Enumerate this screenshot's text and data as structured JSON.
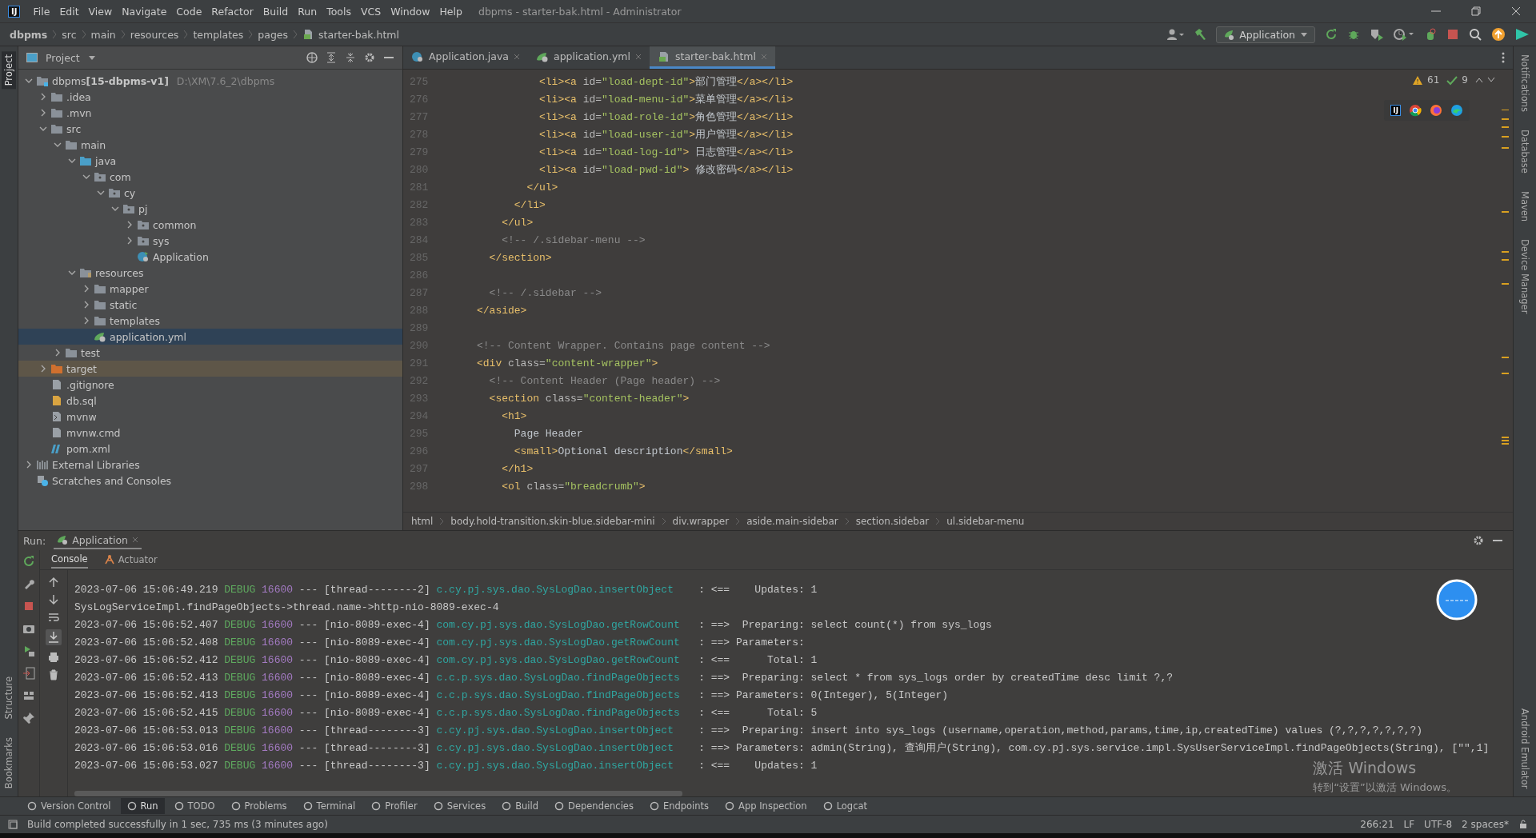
{
  "title_bar": {
    "logo": "IJ",
    "menu": [
      "File",
      "Edit",
      "View",
      "Navigate",
      "Code",
      "Refactor",
      "Build",
      "Run",
      "Tools",
      "VCS",
      "Window",
      "Help"
    ],
    "title": "dbpms - starter-bak.html - Administrator"
  },
  "nav_bar": {
    "breadcrumbs": [
      {
        "label": "dbpms",
        "kind": "project"
      },
      {
        "label": "src",
        "kind": "dir"
      },
      {
        "label": "main",
        "kind": "dir"
      },
      {
        "label": "resources",
        "kind": "dir"
      },
      {
        "label": "templates",
        "kind": "dir"
      },
      {
        "label": "pages",
        "kind": "dir"
      },
      {
        "label": "starter-bak.html",
        "kind": "html"
      }
    ],
    "run_config": "Application"
  },
  "left_stripe": {
    "top": [
      {
        "label": "Project",
        "selected": true
      }
    ],
    "bottom": [
      {
        "label": "Structure",
        "selected": false
      },
      {
        "label": "Bookmarks",
        "selected": false
      }
    ]
  },
  "right_stripe": {
    "top": [
      {
        "label": "Notifications",
        "selected": false
      },
      {
        "label": "Database",
        "selected": false
      },
      {
        "label": "Maven",
        "selected": false
      },
      {
        "label": "Device Manager",
        "selected": false
      }
    ],
    "bottom": [
      {
        "label": "Android Emulator",
        "selected": false
      }
    ]
  },
  "project": {
    "title": "Project",
    "tree": [
      {
        "label": "dbpms",
        "module": "[15-dbpms-v1]",
        "path": "D:\\XM\\7.6_2\\dbpms",
        "kind": "module",
        "expanded": true,
        "selected": false,
        "children": [
          {
            "label": ".idea",
            "kind": "folder",
            "expanded": false,
            "selected": false
          },
          {
            "label": ".mvn",
            "kind": "folder",
            "expanded": false,
            "selected": false
          },
          {
            "label": "src",
            "kind": "folder",
            "expanded": true,
            "selected": false,
            "children": [
              {
                "label": "main",
                "kind": "folder",
                "expanded": true,
                "selected": false,
                "children": [
                  {
                    "label": "java",
                    "kind": "source",
                    "expanded": true,
                    "selected": false,
                    "children": [
                      {
                        "label": "com",
                        "kind": "package",
                        "expanded": true,
                        "selected": false,
                        "children": [
                          {
                            "label": "cy",
                            "kind": "package",
                            "expanded": true,
                            "selected": false,
                            "children": [
                              {
                                "label": "pj",
                                "kind": "package",
                                "expanded": true,
                                "selected": false,
                                "children": [
                                  {
                                    "label": "common",
                                    "kind": "package",
                                    "expanded": false,
                                    "selected": false
                                  },
                                  {
                                    "label": "sys",
                                    "kind": "package",
                                    "expanded": false,
                                    "selected": false
                                  },
                                  {
                                    "label": "Application",
                                    "kind": "class",
                                    "selected": false
                                  }
                                ]
                              }
                            ]
                          }
                        ]
                      }
                    ]
                  },
                  {
                    "label": "resources",
                    "kind": "resources",
                    "expanded": true,
                    "selected": false,
                    "children": [
                      {
                        "label": "mapper",
                        "kind": "folder",
                        "expanded": false,
                        "selected": false
                      },
                      {
                        "label": "static",
                        "kind": "folder",
                        "expanded": false,
                        "selected": false
                      },
                      {
                        "label": "templates",
                        "kind": "folder",
                        "expanded": false,
                        "selected": false
                      },
                      {
                        "label": "application.yml",
                        "kind": "yml",
                        "selected": true
                      }
                    ]
                  }
                ]
              },
              {
                "label": "test",
                "kind": "folder",
                "expanded": false,
                "selected": false
              }
            ]
          },
          {
            "label": "target",
            "kind": "excluded",
            "expanded": false,
            "selected": false
          },
          {
            "label": ".gitignore",
            "kind": "file",
            "selected": false
          },
          {
            "label": "db.sql",
            "kind": "sql",
            "selected": false
          },
          {
            "label": "mvnw",
            "kind": "script",
            "selected": false
          },
          {
            "label": "mvnw.cmd",
            "kind": "file",
            "selected": false
          },
          {
            "label": "pom.xml",
            "kind": "maven",
            "selected": false
          }
        ]
      },
      {
        "label": "External Libraries",
        "kind": "libraries",
        "expanded": false,
        "selected": false
      },
      {
        "label": "Scratches and Consoles",
        "kind": "scratches",
        "selected": false
      }
    ]
  },
  "editor": {
    "tabs": [
      {
        "label": "Application.java",
        "kind": "class",
        "selected": false
      },
      {
        "label": "application.yml",
        "kind": "yml",
        "selected": false
      },
      {
        "label": "starter-bak.html",
        "kind": "html",
        "selected": true
      }
    ],
    "warnings": "61",
    "checks": "9",
    "browser_logo": "IJ",
    "lines": [
      {
        "number": "275",
        "code": [
          {
            "text": "          <li><a ",
            "kind": "tag"
          },
          {
            "text": "id=",
            "kind": "attr"
          },
          {
            "text": "\"load-dept-id\"",
            "kind": "str"
          },
          {
            "text": ">",
            "kind": "tag"
          },
          {
            "text": "部门管理",
            "kind": "text"
          },
          {
            "text": "</a></li>",
            "kind": "tag"
          }
        ]
      },
      {
        "number": "276",
        "code": [
          {
            "text": "          <li><a ",
            "kind": "tag"
          },
          {
            "text": "id=",
            "kind": "attr"
          },
          {
            "text": "\"load-menu-id\"",
            "kind": "str"
          },
          {
            "text": ">",
            "kind": "tag"
          },
          {
            "text": "菜单管理",
            "kind": "text"
          },
          {
            "text": "</a></li>",
            "kind": "tag"
          }
        ]
      },
      {
        "number": "277",
        "code": [
          {
            "text": "          <li><a ",
            "kind": "tag"
          },
          {
            "text": "id=",
            "kind": "attr"
          },
          {
            "text": "\"load-role-id\"",
            "kind": "str"
          },
          {
            "text": ">",
            "kind": "tag"
          },
          {
            "text": "角色管理",
            "kind": "text"
          },
          {
            "text": "</a></li>",
            "kind": "tag"
          }
        ]
      },
      {
        "number": "278",
        "code": [
          {
            "text": "          <li><a ",
            "kind": "tag"
          },
          {
            "text": "id=",
            "kind": "attr"
          },
          {
            "text": "\"load-user-id\"",
            "kind": "str"
          },
          {
            "text": ">",
            "kind": "tag"
          },
          {
            "text": "用户管理",
            "kind": "text"
          },
          {
            "text": "</a></li>",
            "kind": "tag"
          }
        ]
      },
      {
        "number": "279",
        "code": [
          {
            "text": "          <li><a ",
            "kind": "tag"
          },
          {
            "text": "id=",
            "kind": "attr"
          },
          {
            "text": "\"load-log-id\"",
            "kind": "str"
          },
          {
            "text": ">",
            "kind": "tag"
          },
          {
            "text": " 日志管理",
            "kind": "text"
          },
          {
            "text": "</a></li>",
            "kind": "tag"
          }
        ]
      },
      {
        "number": "280",
        "code": [
          {
            "text": "          <li><a ",
            "kind": "tag"
          },
          {
            "text": "id=",
            "kind": "attr"
          },
          {
            "text": "\"load-pwd-id\"",
            "kind": "str"
          },
          {
            "text": ">",
            "kind": "tag"
          },
          {
            "text": " 修改密码",
            "kind": "text"
          },
          {
            "text": "</a></li>",
            "kind": "tag"
          }
        ]
      },
      {
        "number": "281",
        "code": [
          {
            "text": "        </ul>",
            "kind": "tag"
          }
        ]
      },
      {
        "number": "282",
        "code": [
          {
            "text": "      </li>",
            "kind": "tag"
          }
        ]
      },
      {
        "number": "283",
        "code": [
          {
            "text": "    </ul>",
            "kind": "tag"
          }
        ]
      },
      {
        "number": "284",
        "code": [
          {
            "text": "    <!-- /.sidebar-menu -->",
            "kind": "comment"
          }
        ]
      },
      {
        "number": "285",
        "code": [
          {
            "text": "  </section>",
            "kind": "tag"
          }
        ]
      },
      {
        "number": "286"
      },
      {
        "number": "287",
        "code": [
          {
            "text": "  <!-- /.sidebar -->",
            "kind": "comment"
          }
        ]
      },
      {
        "number": "288",
        "code": [
          {
            "text": "</aside>",
            "kind": "tag"
          }
        ]
      },
      {
        "number": "289"
      },
      {
        "number": "290",
        "code": [
          {
            "text": "<!-- Content Wrapper. Contains page content -->",
            "kind": "comment"
          }
        ]
      },
      {
        "number": "291",
        "code": [
          {
            "text": "<div ",
            "kind": "tag"
          },
          {
            "text": "class=",
            "kind": "attr"
          },
          {
            "text": "\"content-wrapper\"",
            "kind": "str"
          },
          {
            "text": ">",
            "kind": "tag"
          }
        ]
      },
      {
        "number": "292",
        "code": [
          {
            "text": "  <!-- Content Header (Page header) -->",
            "kind": "comment"
          }
        ]
      },
      {
        "number": "293",
        "code": [
          {
            "text": "  <section ",
            "kind": "tag"
          },
          {
            "text": "class=",
            "kind": "attr"
          },
          {
            "text": "\"content-header\"",
            "kind": "str"
          },
          {
            "text": ">",
            "kind": "tag"
          }
        ]
      },
      {
        "number": "294",
        "code": [
          {
            "text": "    <h1>",
            "kind": "tag"
          }
        ]
      },
      {
        "number": "295",
        "code": [
          {
            "text": "      Page Header",
            "kind": "text"
          }
        ]
      },
      {
        "number": "296",
        "code": [
          {
            "text": "      <small>",
            "kind": "tag"
          },
          {
            "text": "Optional description",
            "kind": "text"
          },
          {
            "text": "</small>",
            "kind": "tag"
          }
        ]
      },
      {
        "number": "297",
        "code": [
          {
            "text": "    </h1>",
            "kind": "tag"
          }
        ]
      },
      {
        "number": "298",
        "code": [
          {
            "text": "    <ol ",
            "kind": "tag"
          },
          {
            "text": "class=",
            "kind": "attr"
          },
          {
            "text": "\"breadcrumb\"",
            "kind": "str"
          },
          {
            "text": ">",
            "kind": "tag"
          }
        ]
      }
    ],
    "breadcrumb": [
      "html",
      "body.hold-transition.skin-blue.sidebar-mini",
      "div.wrapper",
      "aside.main-sidebar",
      "section.sidebar",
      "ul.sidebar-menu"
    ]
  },
  "run": {
    "label": "Run:",
    "tab": "Application",
    "subtabs": [
      {
        "label": "Console",
        "kind": "console",
        "selected": true
      },
      {
        "label": "Actuator",
        "kind": "actuator",
        "selected": false
      }
    ],
    "lines": [
      {
        "kind": "log",
        "time": "2023-07-06 15:06:49.219",
        "level": "DEBUG",
        "pid": "16600",
        "thread": "--- [thread--------2]",
        "logger": "c.cy.pj.sys.dao.SysLogDao.insertObject",
        "message": ": <==    Updates: 1"
      },
      {
        "kind": "plain",
        "message": "SysLogServiceImpl.findPageObjects->thread.name->http-nio-8089-exec-4"
      },
      {
        "kind": "log",
        "time": "2023-07-06 15:06:52.407",
        "level": "DEBUG",
        "pid": "16600",
        "thread": "--- [nio-8089-exec-4]",
        "logger": "com.cy.pj.sys.dao.SysLogDao.getRowCount",
        "message": ": ==>  Preparing: select count(*) from sys_logs"
      },
      {
        "kind": "log",
        "time": "2023-07-06 15:06:52.408",
        "level": "DEBUG",
        "pid": "16600",
        "thread": "--- [nio-8089-exec-4]",
        "logger": "com.cy.pj.sys.dao.SysLogDao.getRowCount",
        "message": ": ==> Parameters:"
      },
      {
        "kind": "log",
        "time": "2023-07-06 15:06:52.412",
        "level": "DEBUG",
        "pid": "16600",
        "thread": "--- [nio-8089-exec-4]",
        "logger": "com.cy.pj.sys.dao.SysLogDao.getRowCount",
        "message": ": <==      Total: 1"
      },
      {
        "kind": "log",
        "time": "2023-07-06 15:06:52.413",
        "level": "DEBUG",
        "pid": "16600",
        "thread": "--- [nio-8089-exec-4]",
        "logger": "c.c.p.sys.dao.SysLogDao.findPageObjects",
        "message": ": ==>  Preparing: select * from sys_logs order by createdTime desc limit ?,?"
      },
      {
        "kind": "log",
        "time": "2023-07-06 15:06:52.413",
        "level": "DEBUG",
        "pid": "16600",
        "thread": "--- [nio-8089-exec-4]",
        "logger": "c.c.p.sys.dao.SysLogDao.findPageObjects",
        "message": ": ==> Parameters: 0(Integer), 5(Integer)"
      },
      {
        "kind": "log",
        "time": "2023-07-06 15:06:52.415",
        "level": "DEBUG",
        "pid": "16600",
        "thread": "--- [nio-8089-exec-4]",
        "logger": "c.c.p.sys.dao.SysLogDao.findPageObjects",
        "message": ": <==      Total: 5"
      },
      {
        "kind": "log",
        "time": "2023-07-06 15:06:53.013",
        "level": "DEBUG",
        "pid": "16600",
        "thread": "--- [thread--------3]",
        "logger": "c.cy.pj.sys.dao.SysLogDao.insertObject",
        "message": ": ==>  Preparing: insert into sys_logs (username,operation,method,params,time,ip,createdTime) values (?,?,?,?,?,?,?)"
      },
      {
        "kind": "log",
        "time": "2023-07-06 15:06:53.016",
        "level": "DEBUG",
        "pid": "16600",
        "thread": "--- [thread--------3]",
        "logger": "c.cy.pj.sys.dao.SysLogDao.insertObject",
        "message": ": ==> Parameters: admin(String), 查询用户(String), com.cy.pj.sys.service.impl.SysUserServiceImpl.findPageObjects(String), [\"\",1]"
      },
      {
        "kind": "log",
        "time": "2023-07-06 15:06:53.027",
        "level": "DEBUG",
        "pid": "16600",
        "thread": "--- [thread--------3]",
        "logger": "c.cy.pj.sys.dao.SysLogDao.insertObject",
        "message": ": <==    Updates: 1"
      }
    ]
  },
  "activation": {
    "title": "激活 Windows",
    "hint": "转到“设置”以激活 Windows。"
  },
  "tool_windows": [
    {
      "label": "Version Control",
      "selected": false
    },
    {
      "label": "Run",
      "selected": true
    },
    {
      "label": "TODO",
      "selected": false
    },
    {
      "label": "Problems",
      "selected": false
    },
    {
      "label": "Terminal",
      "selected": false
    },
    {
      "label": "Profiler",
      "selected": false
    },
    {
      "label": "Services",
      "selected": false
    },
    {
      "label": "Build",
      "selected": false
    },
    {
      "label": "Dependencies",
      "selected": false
    },
    {
      "label": "Endpoints",
      "selected": false
    },
    {
      "label": "App Inspection",
      "selected": false
    },
    {
      "label": "Logcat",
      "selected": false
    }
  ],
  "status_bar": {
    "message": "Build completed successfully in 1 sec, 735 ms (3 minutes ago)",
    "items": [
      "266:21",
      "LF",
      "UTF-8",
      "2 spaces*"
    ]
  }
}
